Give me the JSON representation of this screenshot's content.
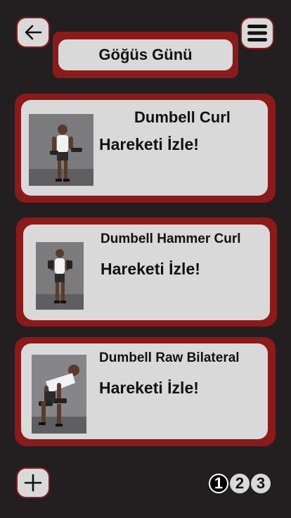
{
  "header": {
    "title": "Göğüs Günü",
    "back_icon": "arrow-left-icon",
    "menu_icon": "hamburger-menu-icon"
  },
  "exercises": [
    {
      "name": "Dumbell Curl",
      "link": "Hareketi İzle!"
    },
    {
      "name": "Dumbell Hammer Curl",
      "link": "Hareketi İzle!"
    },
    {
      "name": "Dumbell Raw Bilateral",
      "link": "Hareketi İzle!"
    }
  ],
  "footer": {
    "add_icon": "plus-icon",
    "pages": [
      "1",
      "2",
      "3"
    ],
    "active_page": "1"
  },
  "colors": {
    "background": "#231f20",
    "accent": "#8b1a1a",
    "card": "#d9d9d9"
  }
}
